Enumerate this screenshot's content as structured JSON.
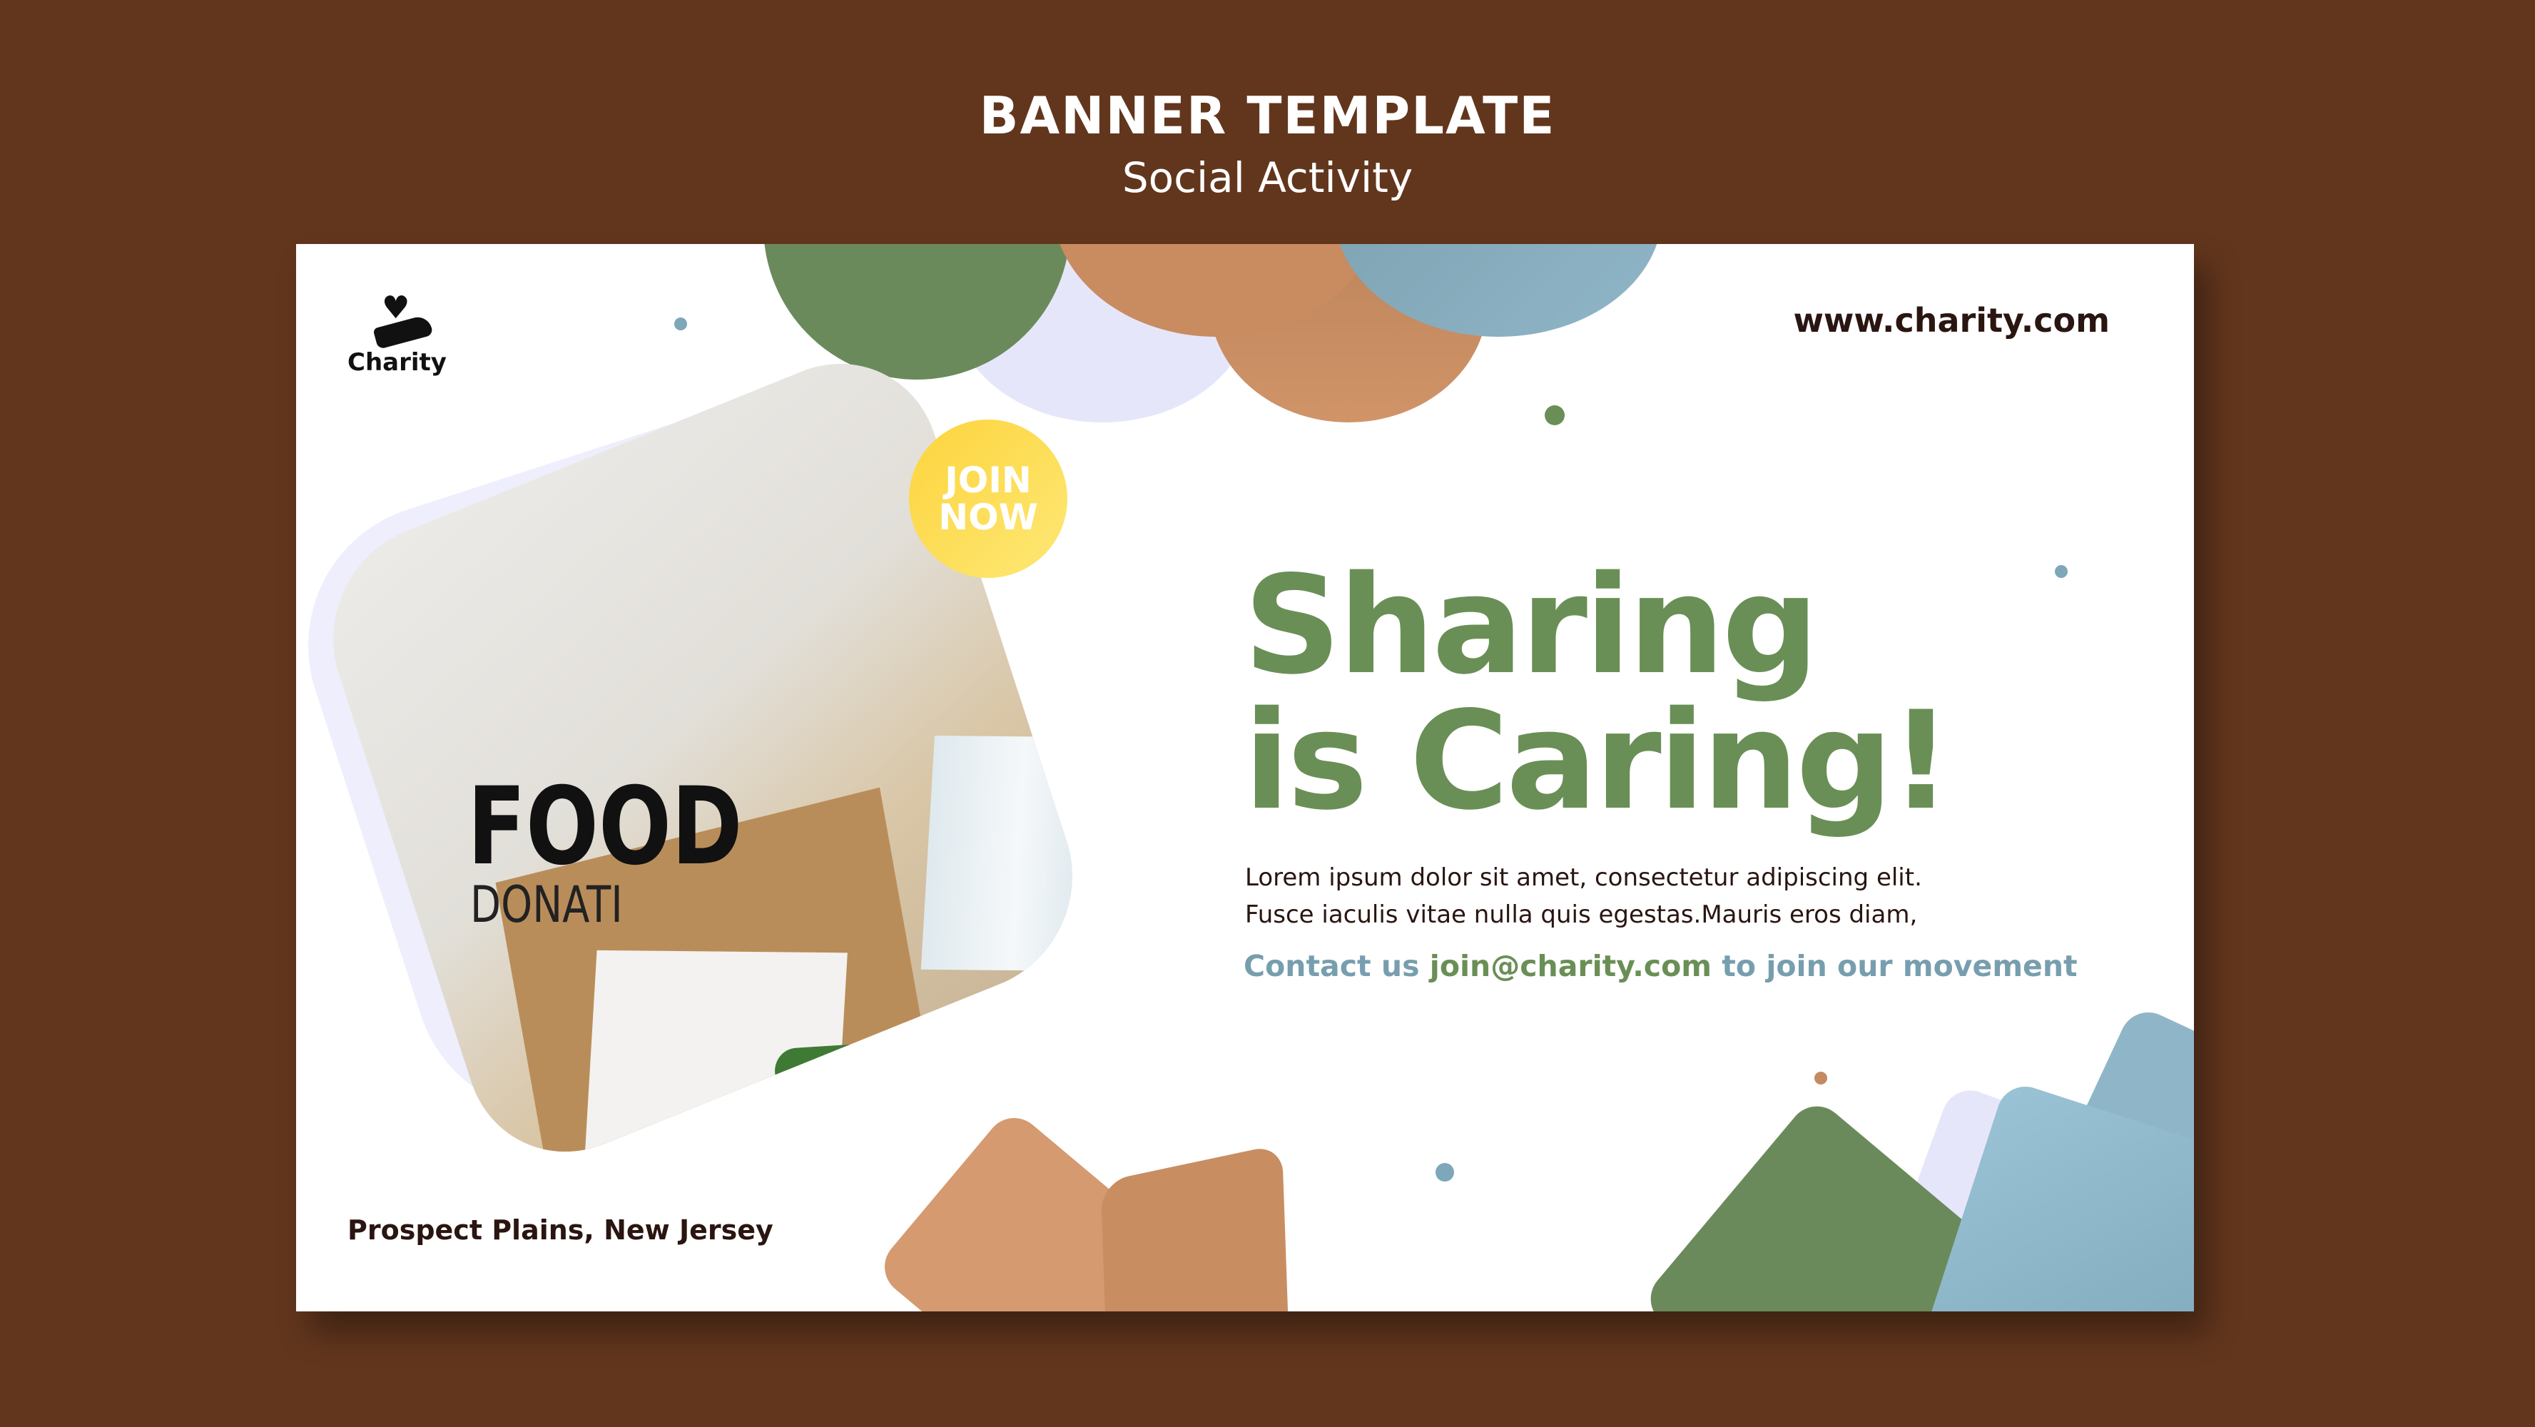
{
  "header": {
    "title": "BANNER TEMPLATE",
    "subtitle": "Social Activity"
  },
  "banner": {
    "logo_text": "Charity",
    "url": "www.charity.com",
    "join_badge": {
      "line1": "JOIN",
      "line2": "NOW"
    },
    "photo_text": {
      "food": "FOOD",
      "donation": "DONATI"
    },
    "headline": {
      "line1": "Sharing",
      "line2": "is Caring!"
    },
    "body": [
      "Lorem ipsum dolor sit amet, consectetur adipiscing elit.",
      "Fusce iaculis vitae nulla quis egestas.Mauris eros diam,"
    ],
    "contact": {
      "prefix": "Contact us ",
      "email": "join@charity.com",
      "suffix": " to join our movement"
    },
    "location": "Prospect Plains, New Jersey"
  },
  "colors": {
    "background": "#62361d",
    "green": "#6a8f56",
    "tan": "#c88b61",
    "blue": "#7ea7b9",
    "yellow": "#fdd43c",
    "lavender": "#e6e6fb"
  }
}
